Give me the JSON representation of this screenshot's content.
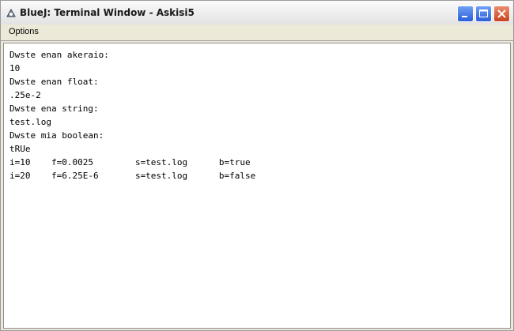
{
  "window": {
    "title": "BlueJ: Terminal Window - Askisi5",
    "controls": {
      "minimize": "minimize-icon",
      "maximize": "maximize-icon",
      "close": "close-icon"
    }
  },
  "menu": {
    "items": [
      {
        "label": "Options"
      }
    ]
  },
  "terminal": {
    "lines": [
      "Dwste enan akeraio:",
      "10",
      "Dwste enan float:",
      ".25e-2",
      "Dwste ena string:",
      "test.log",
      "Dwste mia boolean:",
      "tRUe",
      "i=10    f=0.0025        s=test.log      b=true",
      "i=20    f=6.25E-6       s=test.log      b=false"
    ]
  },
  "colors": {
    "close": "#c7431f",
    "minmax": "#2a5fd8"
  }
}
